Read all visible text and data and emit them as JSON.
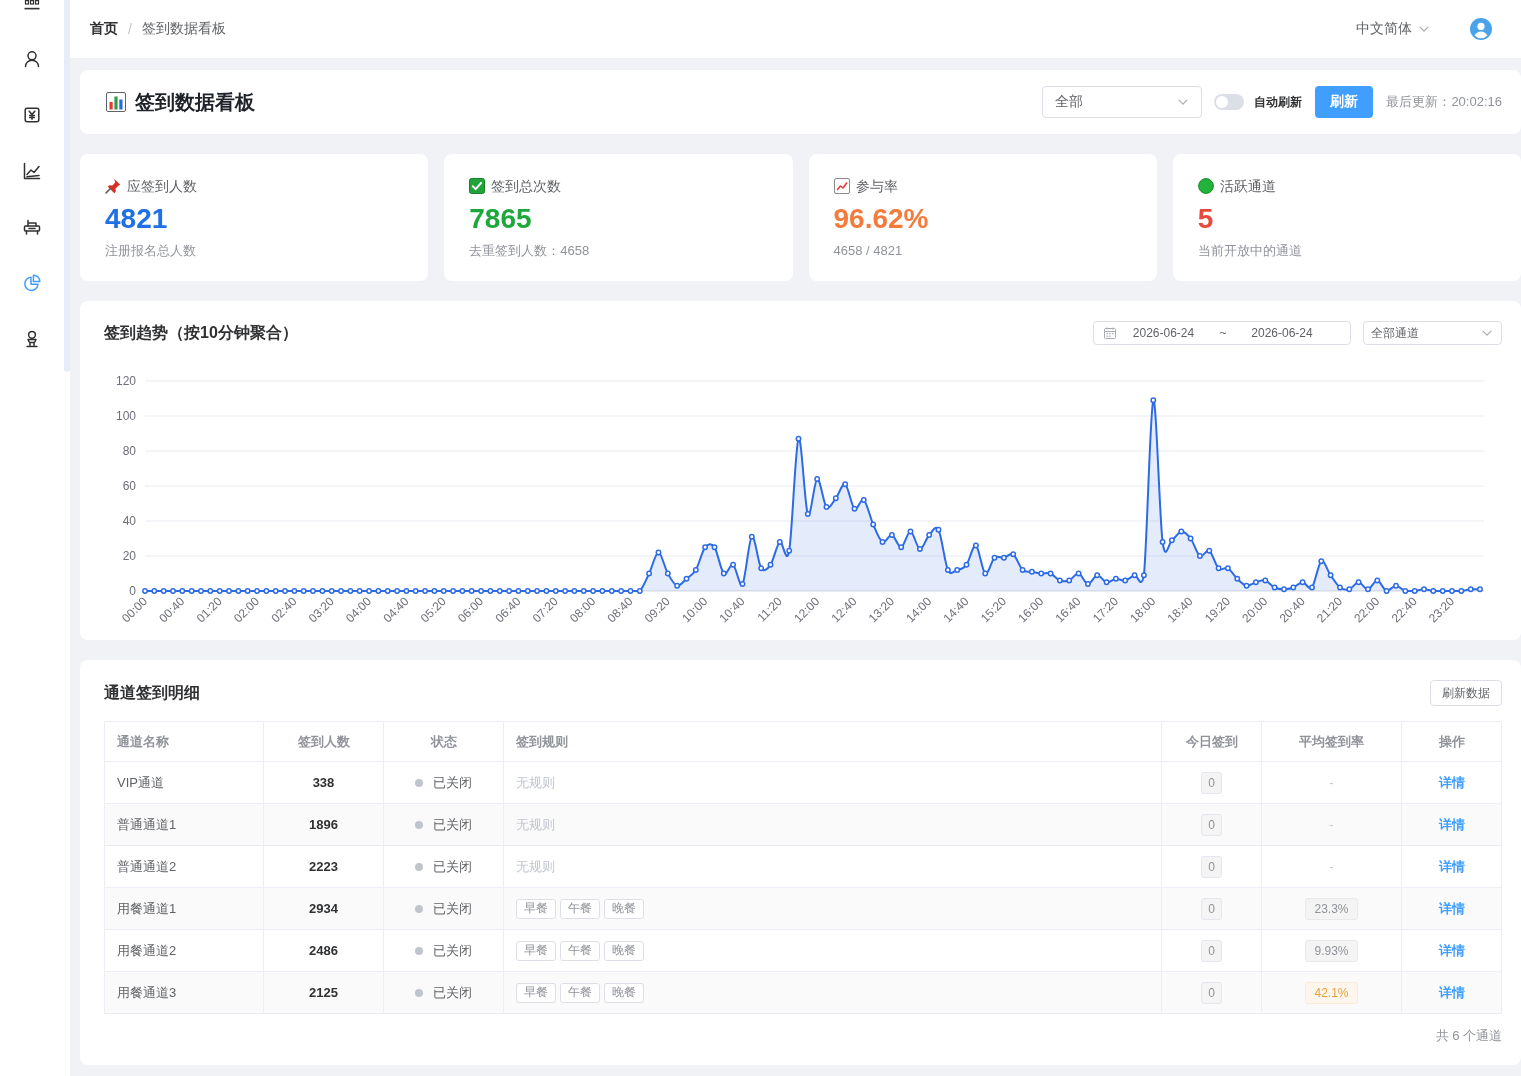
{
  "sidebar": {
    "items": [
      {
        "selected": false
      },
      {
        "selected": false
      },
      {
        "selected": false
      },
      {
        "selected": false
      },
      {
        "selected": false
      },
      {
        "selected": true
      },
      {
        "selected": false
      }
    ]
  },
  "breadcrumb": {
    "items": [
      {
        "label": "首页"
      },
      {
        "label": "签到数据看板"
      }
    ],
    "separator": "/"
  },
  "header": {
    "language": "中文简体"
  },
  "page_header": {
    "title": "签到数据看板",
    "scope_select": {
      "value": "全部"
    },
    "auto_refresh": {
      "label": "自动刷新",
      "on": false
    },
    "refresh_button": "刷新",
    "last_updated": "最后更新：20:02:16"
  },
  "stats": [
    {
      "label": "应签到人数",
      "value": "4821",
      "color": "#1f6fe5",
      "note": "注册报名总人数"
    },
    {
      "label": "签到总次数",
      "value": "7865",
      "color": "#1ea83c",
      "note": "去重签到人数：4658"
    },
    {
      "label": "参与率",
      "value": "96.62%",
      "color": "#f47b3c",
      "note": "4658 / 4821"
    },
    {
      "label": "活跃通道",
      "value": "5",
      "color": "#e84a3c",
      "note": "当前开放中的通道"
    }
  ],
  "trend": {
    "title": "签到趋势（按10分钟聚合）",
    "date_range": {
      "start": "2026-06-24",
      "separator": "~",
      "end": "2026-06-24"
    },
    "channel_select": {
      "value": "全部通道"
    },
    "chart_data": {
      "type": "area",
      "grid": true,
      "x": [
        0,
        10,
        20,
        30,
        40,
        50,
        60,
        70,
        80,
        90,
        100,
        110,
        120,
        130,
        140,
        150,
        160,
        170,
        180,
        190,
        200,
        210,
        220,
        230,
        240,
        250,
        260,
        270,
        280,
        290,
        300,
        310,
        320,
        330,
        340,
        350,
        360,
        370,
        380,
        390,
        400,
        410,
        420,
        430,
        440,
        450,
        460,
        470,
        480,
        490,
        500,
        510,
        520,
        530,
        540,
        550,
        560,
        570,
        580,
        590,
        600,
        610,
        620,
        630,
        640,
        650,
        660,
        670,
        680,
        690,
        700,
        710,
        720,
        730,
        740,
        750,
        760,
        770,
        780,
        790,
        800,
        810,
        820,
        830,
        840,
        850,
        860,
        870,
        880,
        890,
        900,
        910,
        920,
        930,
        940,
        950,
        960,
        970,
        980,
        990,
        1000,
        1010,
        1020,
        1030,
        1040,
        1050,
        1060,
        1070,
        1080,
        1090,
        1100,
        1110,
        1120,
        1130,
        1140,
        1150,
        1160,
        1170,
        1180,
        1190,
        1200,
        1210,
        1220,
        1230,
        1240,
        1250,
        1260,
        1270,
        1280,
        1290,
        1300,
        1310,
        1320,
        1330,
        1340,
        1350,
        1360,
        1370,
        1380,
        1390,
        1400,
        1410,
        1420,
        1430
      ],
      "series": [
        {
          "color": "#2d6be5",
          "values": [
            0,
            0,
            0,
            0,
            0,
            0,
            0,
            0,
            0,
            0,
            0,
            0,
            0,
            0,
            0,
            0,
            0,
            0,
            0,
            0,
            0,
            0,
            0,
            0,
            0,
            0,
            0,
            0,
            0,
            0,
            0,
            0,
            0,
            0,
            0,
            0,
            0,
            0,
            0,
            0,
            0,
            0,
            0,
            0,
            0,
            0,
            0,
            0,
            0,
            0,
            0,
            0,
            0,
            0,
            10,
            22,
            10,
            3,
            7,
            12,
            25,
            25,
            10,
            15,
            4,
            31,
            13,
            15,
            28,
            23,
            87,
            44,
            64,
            48,
            53,
            61,
            47,
            52,
            38,
            28,
            32,
            25,
            34,
            24,
            32,
            35,
            12,
            12,
            15,
            26,
            10,
            19,
            19,
            21,
            12,
            11,
            10,
            10,
            6,
            6,
            10,
            4,
            9,
            5,
            7,
            6,
            9,
            9,
            109,
            28,
            29,
            34,
            30,
            20,
            23,
            13,
            13,
            7,
            3,
            5,
            6,
            2,
            1,
            2,
            5,
            2,
            17,
            9,
            2,
            1,
            5,
            1,
            6,
            0,
            3,
            0,
            0,
            1,
            0,
            0,
            0,
            0,
            1,
            1
          ]
        }
      ],
      "xlim": [
        0,
        1430
      ],
      "ylim": [
        0,
        120
      ],
      "yticks": [
        0,
        20,
        40,
        60,
        80,
        100,
        120
      ],
      "xticks": [
        {
          "value": 0,
          "label": "00:00"
        },
        {
          "value": 40,
          "label": "00:40"
        },
        {
          "value": 80,
          "label": "01:20"
        },
        {
          "value": 120,
          "label": "02:00"
        },
        {
          "value": 160,
          "label": "02:40"
        },
        {
          "value": 200,
          "label": "03:20"
        },
        {
          "value": 240,
          "label": "04:00"
        },
        {
          "value": 280,
          "label": "04:40"
        },
        {
          "value": 320,
          "label": "05:20"
        },
        {
          "value": 360,
          "label": "06:00"
        },
        {
          "value": 400,
          "label": "06:40"
        },
        {
          "value": 440,
          "label": "07:20"
        },
        {
          "value": 480,
          "label": "08:00"
        },
        {
          "value": 520,
          "label": "08:40"
        },
        {
          "value": 560,
          "label": "09:20"
        },
        {
          "value": 600,
          "label": "10:00"
        },
        {
          "value": 640,
          "label": "10:40"
        },
        {
          "value": 680,
          "label": "11:20"
        },
        {
          "value": 720,
          "label": "12:00"
        },
        {
          "value": 760,
          "label": "12:40"
        },
        {
          "value": 800,
          "label": "13:20"
        },
        {
          "value": 840,
          "label": "14:00"
        },
        {
          "value": 880,
          "label": "14:40"
        },
        {
          "value": 920,
          "label": "15:20"
        },
        {
          "value": 960,
          "label": "16:00"
        },
        {
          "value": 1000,
          "label": "16:40"
        },
        {
          "value": 1040,
          "label": "17:20"
        },
        {
          "value": 1080,
          "label": "18:00"
        },
        {
          "value": 1120,
          "label": "18:40"
        },
        {
          "value": 1160,
          "label": "19:20"
        },
        {
          "value": 1200,
          "label": "20:00"
        },
        {
          "value": 1240,
          "label": "20:40"
        },
        {
          "value": 1280,
          "label": "21:20"
        },
        {
          "value": 1320,
          "label": "22:00"
        },
        {
          "value": 1360,
          "label": "22:40"
        },
        {
          "value": 1400,
          "label": "23:20"
        }
      ]
    }
  },
  "channels": {
    "title": "通道签到明细",
    "refresh_button": "刷新数据",
    "table": {
      "columns": [
        "通道名称",
        "签到人数",
        "状态",
        "签到规则",
        "今日签到",
        "平均签到率",
        "操作"
      ],
      "rows": [
        {
          "name": "VIP通道",
          "count": "338",
          "status": "已关闭",
          "active": false,
          "rule": {
            "kind": "note",
            "text": "无规则"
          },
          "today": "0",
          "rate": {
            "kind": "plain",
            "text": "-"
          },
          "action": "详情"
        },
        {
          "name": "普通通道1",
          "count": "1896",
          "status": "已关闭",
          "active": false,
          "rule": {
            "kind": "note",
            "text": "无规则"
          },
          "today": "0",
          "rate": {
            "kind": "plain",
            "text": "-"
          },
          "action": "详情"
        },
        {
          "name": "普通通道2",
          "count": "2223",
          "status": "已关闭",
          "active": false,
          "rule": {
            "kind": "note",
            "text": "无规则"
          },
          "today": "0",
          "rate": {
            "kind": "plain",
            "text": "-"
          },
          "action": "详情"
        },
        {
          "name": "用餐通道1",
          "count": "2934",
          "status": "已关闭",
          "active": false,
          "rule": {
            "kind": "tags",
            "tags": [
              "早餐",
              "午餐",
              "晚餐"
            ]
          },
          "today": "0",
          "rate": {
            "kind": "info",
            "text": "23.3%"
          },
          "action": "详情"
        },
        {
          "name": "用餐通道2",
          "count": "2486",
          "status": "已关闭",
          "active": false,
          "rule": {
            "kind": "tags",
            "tags": [
              "早餐",
              "午餐",
              "晚餐"
            ]
          },
          "today": "0",
          "rate": {
            "kind": "info",
            "text": "9.93%"
          },
          "action": "详情"
        },
        {
          "name": "用餐通道3",
          "count": "2125",
          "status": "已关闭",
          "active": false,
          "rule": {
            "kind": "tags",
            "tags": [
              "早餐",
              "午餐",
              "晚餐"
            ]
          },
          "today": "0",
          "rate": {
            "kind": "warning",
            "text": "42.1%"
          },
          "action": "详情"
        }
      ]
    },
    "footer": "共 6 个通道"
  }
}
